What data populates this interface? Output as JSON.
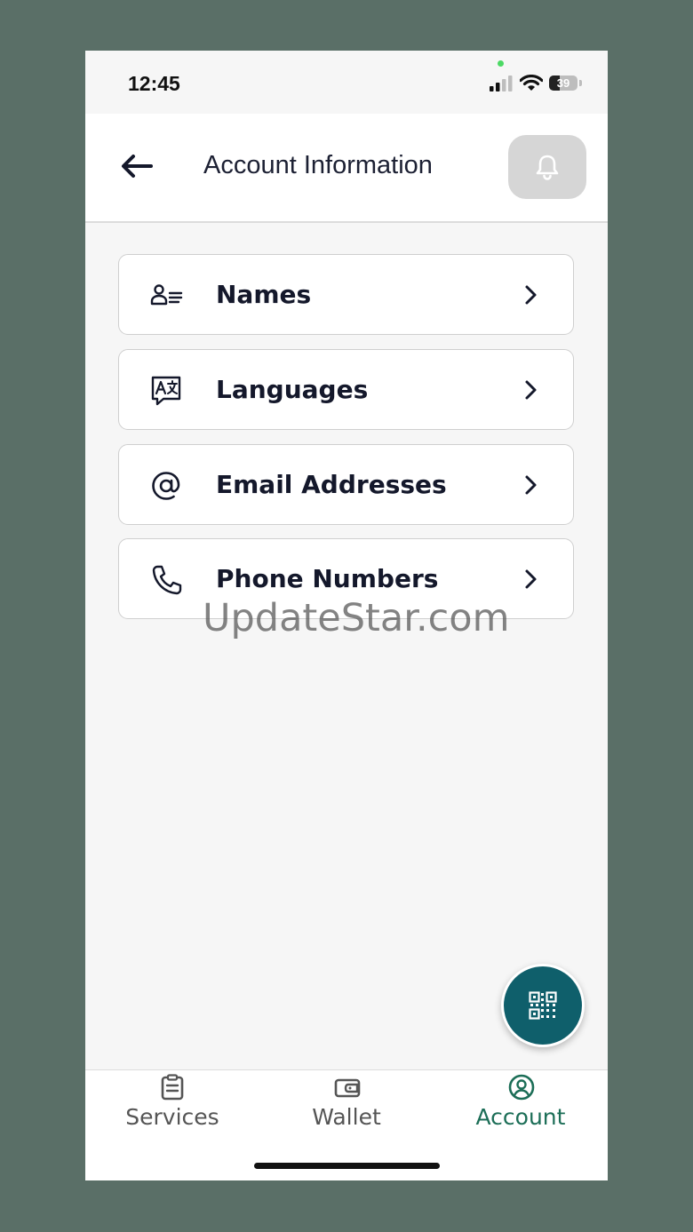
{
  "status_bar": {
    "time": "12:45",
    "battery_percent": "39",
    "battery_level": 0.39
  },
  "header": {
    "title": "Account Information",
    "back_icon": "arrow-left-icon",
    "notification_icon": "bell-icon"
  },
  "menu": {
    "items": [
      {
        "label": "Names",
        "icon": "person-lines-icon"
      },
      {
        "label": "Languages",
        "icon": "translate-icon"
      },
      {
        "label": "Email Addresses",
        "icon": "at-sign-icon"
      },
      {
        "label": "Phone Numbers",
        "icon": "phone-icon"
      }
    ]
  },
  "watermark": "UpdateStar.com",
  "fab": {
    "icon": "qr-code-icon"
  },
  "bottom_nav": {
    "items": [
      {
        "label": "Services",
        "icon": "clipboard-icon",
        "active": false
      },
      {
        "label": "Wallet",
        "icon": "wallet-icon",
        "active": false
      },
      {
        "label": "Account",
        "icon": "user-circle-icon",
        "active": true
      }
    ]
  },
  "colors": {
    "background": "#5a6f67",
    "accent": "#0f5f6b",
    "active_nav": "#1c6e57",
    "text_primary": "#14182b"
  }
}
